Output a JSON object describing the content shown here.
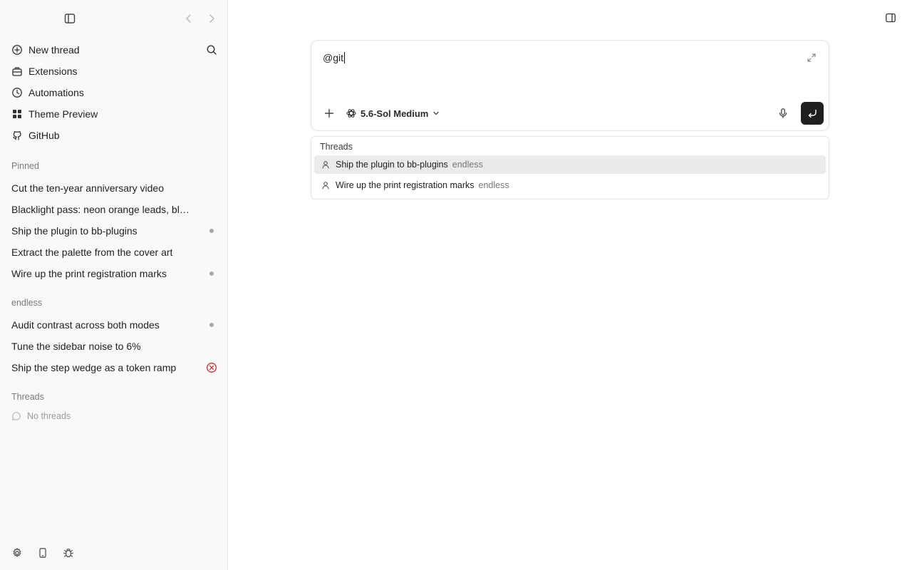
{
  "sidebar": {
    "menu": [
      {
        "label": "New thread",
        "icon": "new-thread-icon"
      },
      {
        "label": "Extensions",
        "icon": "extensions-icon"
      },
      {
        "label": "Automations",
        "icon": "clock-icon"
      },
      {
        "label": "Theme Preview",
        "icon": "grid-icon"
      },
      {
        "label": "GitHub",
        "icon": "github-icon"
      }
    ],
    "pinned": {
      "label": "Pinned",
      "items": [
        {
          "label": "Cut the ten-year anniversary video",
          "status": "none"
        },
        {
          "label": "Blacklight pass: neon orange leads, blu...",
          "status": "none"
        },
        {
          "label": "Ship the plugin to bb-plugins",
          "status": "dot"
        },
        {
          "label": "Extract the palette from the cover art",
          "status": "none"
        },
        {
          "label": "Wire up the print registration marks",
          "status": "dot"
        }
      ]
    },
    "project": {
      "label": "endless",
      "items": [
        {
          "label": "Audit contrast across both modes",
          "status": "dot"
        },
        {
          "label": "Tune the sidebar noise to 6%",
          "status": "none"
        },
        {
          "label": "Ship the step wedge as a token ramp",
          "status": "error"
        }
      ]
    },
    "threads": {
      "label": "Threads",
      "empty": "No threads"
    },
    "bottom_icons": [
      "settings-icon",
      "phone-icon",
      "bug-icon"
    ]
  },
  "composer": {
    "value": "@git",
    "model": "5.6-Sol Medium"
  },
  "suggestions": {
    "heading": "Threads",
    "rows": [
      {
        "title": "Ship the plugin to bb-plugins",
        "tag": "endless",
        "active": true
      },
      {
        "title": "Wire up the print registration marks",
        "tag": "endless",
        "active": false
      }
    ]
  },
  "colors": {
    "sidebar_bg": "#f9f9f9",
    "dot": "#a9a9a9",
    "error": "#d32a2a",
    "send_bg": "#1f1f1f",
    "active_row": "#ebebeb"
  }
}
